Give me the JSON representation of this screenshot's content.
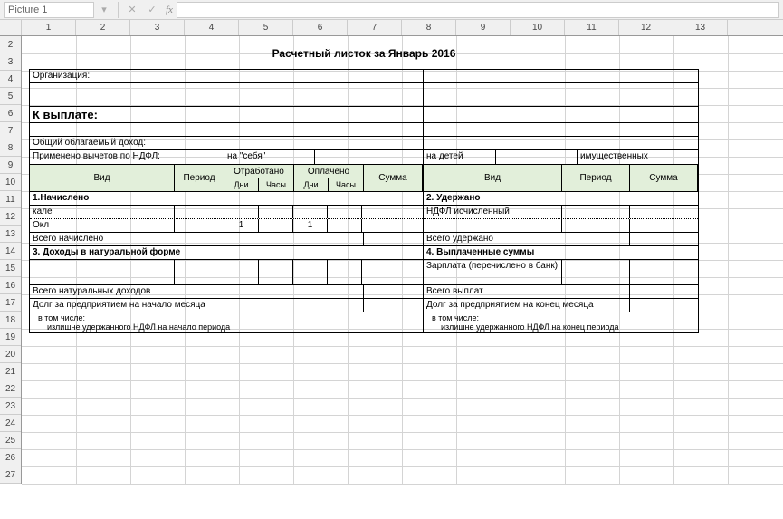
{
  "toolbar": {
    "name_box": "Picture 1",
    "fx": "fx"
  },
  "columns": [
    "1",
    "2",
    "3",
    "4",
    "5",
    "6",
    "7",
    "8",
    "9",
    "10",
    "11",
    "12",
    "13"
  ],
  "rows": [
    "2",
    "3",
    "4",
    "5",
    "6",
    "7",
    "8",
    "9",
    "10",
    "11",
    "12",
    "13",
    "14",
    "15",
    "16",
    "17",
    "18",
    "19",
    "20",
    "21",
    "22",
    "23",
    "24",
    "25",
    "26",
    "27"
  ],
  "title": "Расчетный листок за Январь 2016",
  "header": {
    "org_label": "Организация:",
    "payout_label": "К выплате:",
    "taxable_label": "Общий облагаемый доход:",
    "deduct_label": "Применено вычетов по НДФЛ:",
    "self": "на \"себя\"",
    "children": "на детей",
    "property": "имущественных"
  },
  "cols": {
    "vid": "Вид",
    "period": "Период",
    "worked": "Отработано",
    "paid": "Оплачено",
    "sum": "Сумма",
    "dni": "Дни",
    "chasy": "Часы"
  },
  "sections": {
    "accrued": "1.Начислено",
    "withheld": "2. Удержано",
    "natural": "3. Доходы в натуральной форме",
    "paid_out": "4. Выплаченные суммы"
  },
  "rows_left": {
    "kale": "кале",
    "okl": "Окл",
    "okl_v1": "1",
    "okl_v2": "1",
    "total_accrued": "Всего начислено",
    "total_natural": "Всего натуральных доходов",
    "debt_start": "Долг за предприятием на начало месяца",
    "note1": "в том числе:",
    "note2": "излишне удержанного НДФЛ на начало периода"
  },
  "rows_right": {
    "ndfl": "НДФЛ исчисленный",
    "total_withheld": "Всего удержано",
    "salary_bank": "Зарплата (перечислено в банк)",
    "total_paid": "Всего выплат",
    "debt_end": "Долг за предприятием на конец месяца",
    "debt_end_val": "",
    "note1": "в том числе:",
    "note2": "излишне удержанного НДФЛ на конец периода"
  }
}
